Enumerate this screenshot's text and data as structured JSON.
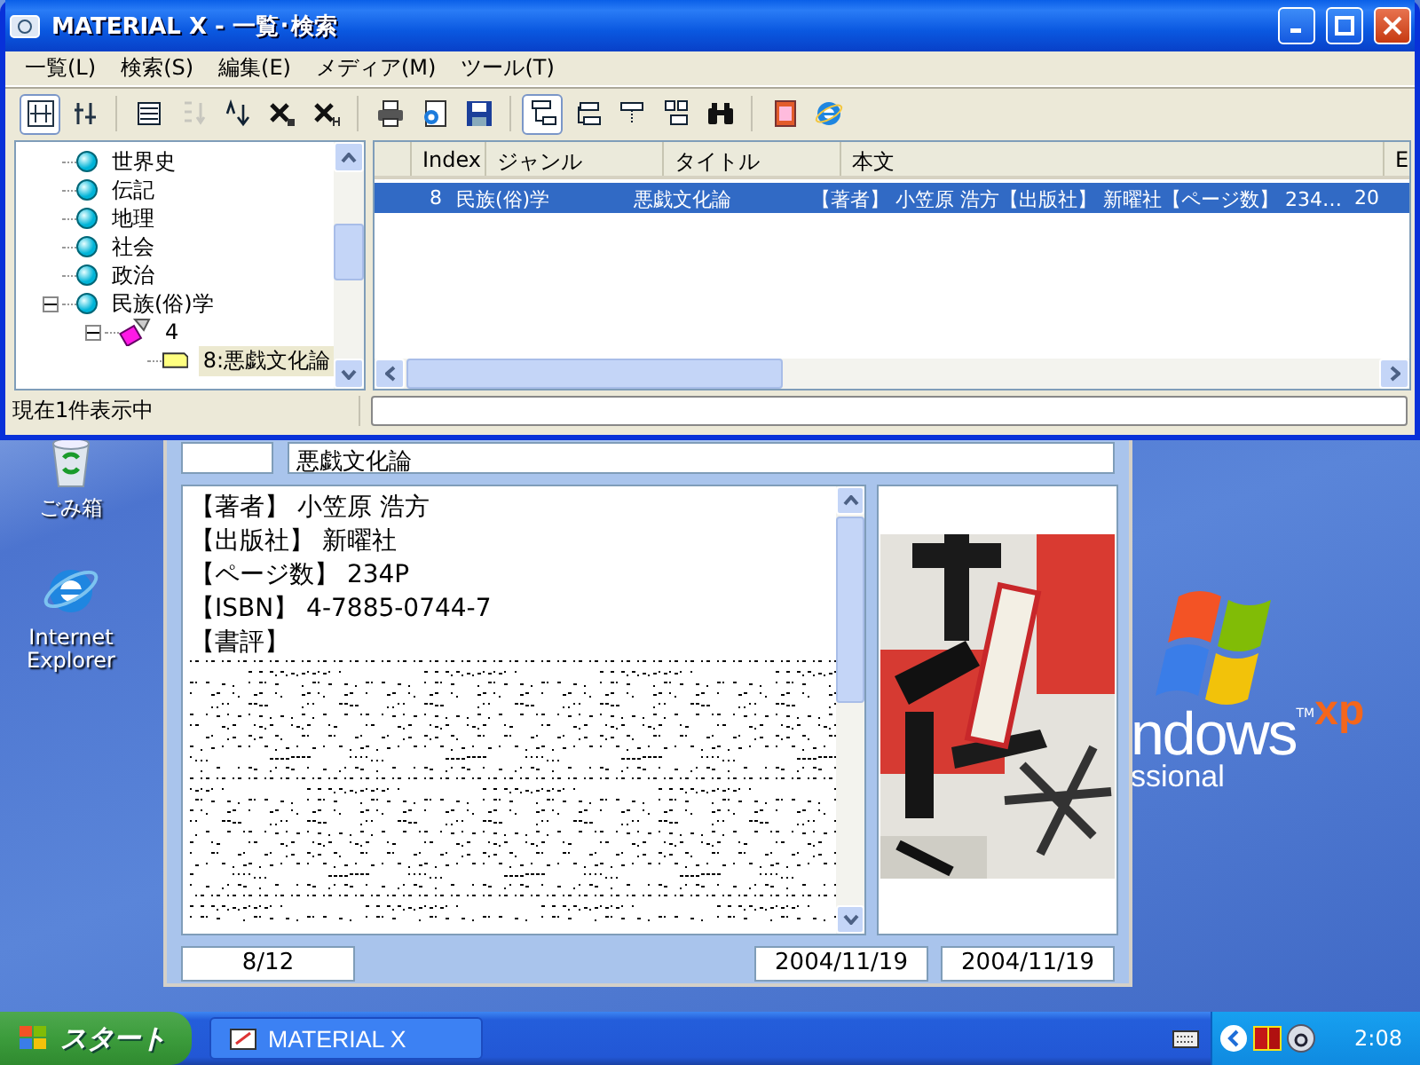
{
  "main_window": {
    "title": "MATERIAL X - 一覧･検索",
    "menu": [
      "一覧(L)",
      "検索(S)",
      "編集(E)",
      "メディア(M)",
      "ツール(T)"
    ],
    "toolbar_groups": [
      {
        "buttons": [
          {
            "pressed": true,
            "disabled": false
          },
          {
            "pressed": false,
            "disabled": false
          }
        ]
      },
      {
        "buttons": [
          {
            "pressed": false,
            "disabled": false
          },
          {
            "pressed": false,
            "disabled": true
          },
          {
            "pressed": false,
            "disabled": false
          },
          {
            "pressed": false,
            "disabled": false
          },
          {
            "pressed": false,
            "disabled": false
          }
        ]
      },
      {
        "buttons": [
          {
            "pressed": false,
            "disabled": false
          },
          {
            "pressed": false,
            "disabled": false
          },
          {
            "pressed": false,
            "disabled": false
          }
        ]
      },
      {
        "buttons": [
          {
            "pressed": true,
            "disabled": false
          },
          {
            "pressed": false,
            "disabled": false
          },
          {
            "pressed": false,
            "disabled": false
          },
          {
            "pressed": false,
            "disabled": false
          },
          {
            "pressed": false,
            "disabled": false
          }
        ]
      },
      {
        "buttons": [
          {
            "pressed": false,
            "disabled": false
          },
          {
            "pressed": false,
            "disabled": false
          }
        ]
      }
    ],
    "tree": [
      {
        "label": "世界史",
        "kind": "genre",
        "selected": false
      },
      {
        "label": "伝記",
        "kind": "genre",
        "selected": false
      },
      {
        "label": "地理",
        "kind": "genre",
        "selected": false
      },
      {
        "label": "社会",
        "kind": "genre",
        "selected": false
      },
      {
        "label": "政治",
        "kind": "genre",
        "selected": false
      },
      {
        "label": "民族(俗)学",
        "kind": "genre",
        "selected": false,
        "expanded": true,
        "children": [
          {
            "label": "4",
            "kind": "volume",
            "selected": false,
            "expanded": true,
            "children": [
              {
                "label": "8:悪戯文化論",
                "kind": "record",
                "selected": true
              }
            ]
          }
        ]
      }
    ],
    "list": {
      "columns": [
        "Index",
        "ジャンル",
        "タイトル",
        "本文",
        "E"
      ],
      "rows": [
        {
          "selected": true,
          "cells": [
            "8",
            "民族(俗)学",
            "悪戯文化論",
            "【著者】 小笠原 浩方【出版社】 新曜社【ページ数】 234…",
            "20"
          ]
        }
      ]
    },
    "status_text": "現在1件表示中"
  },
  "detail_window": {
    "title_field": "悪戯文化論",
    "body_lines": [
      "【著者】 小笠原 浩方",
      "【出版社】 新曜社",
      "【ページ数】 234P",
      "【ISBN】 4-7885-0744-7",
      "【書評】"
    ],
    "footer": [
      "8/12",
      "2004/11/19",
      "2004/11/19"
    ]
  },
  "desktop_icons": [
    {
      "label": "ごみ箱",
      "kind": "recycle"
    },
    {
      "label": "Internet Explorer",
      "kind": "browser"
    }
  ],
  "wallpaper_logo": {
    "word": "ndows",
    "mark": "TM",
    "suffix": "xp",
    "edition": "ssional"
  },
  "taskbar": {
    "start": "スタート",
    "tasks": [
      {
        "label": "MATERIAL X",
        "selected": false
      }
    ],
    "clock": "2:08"
  }
}
